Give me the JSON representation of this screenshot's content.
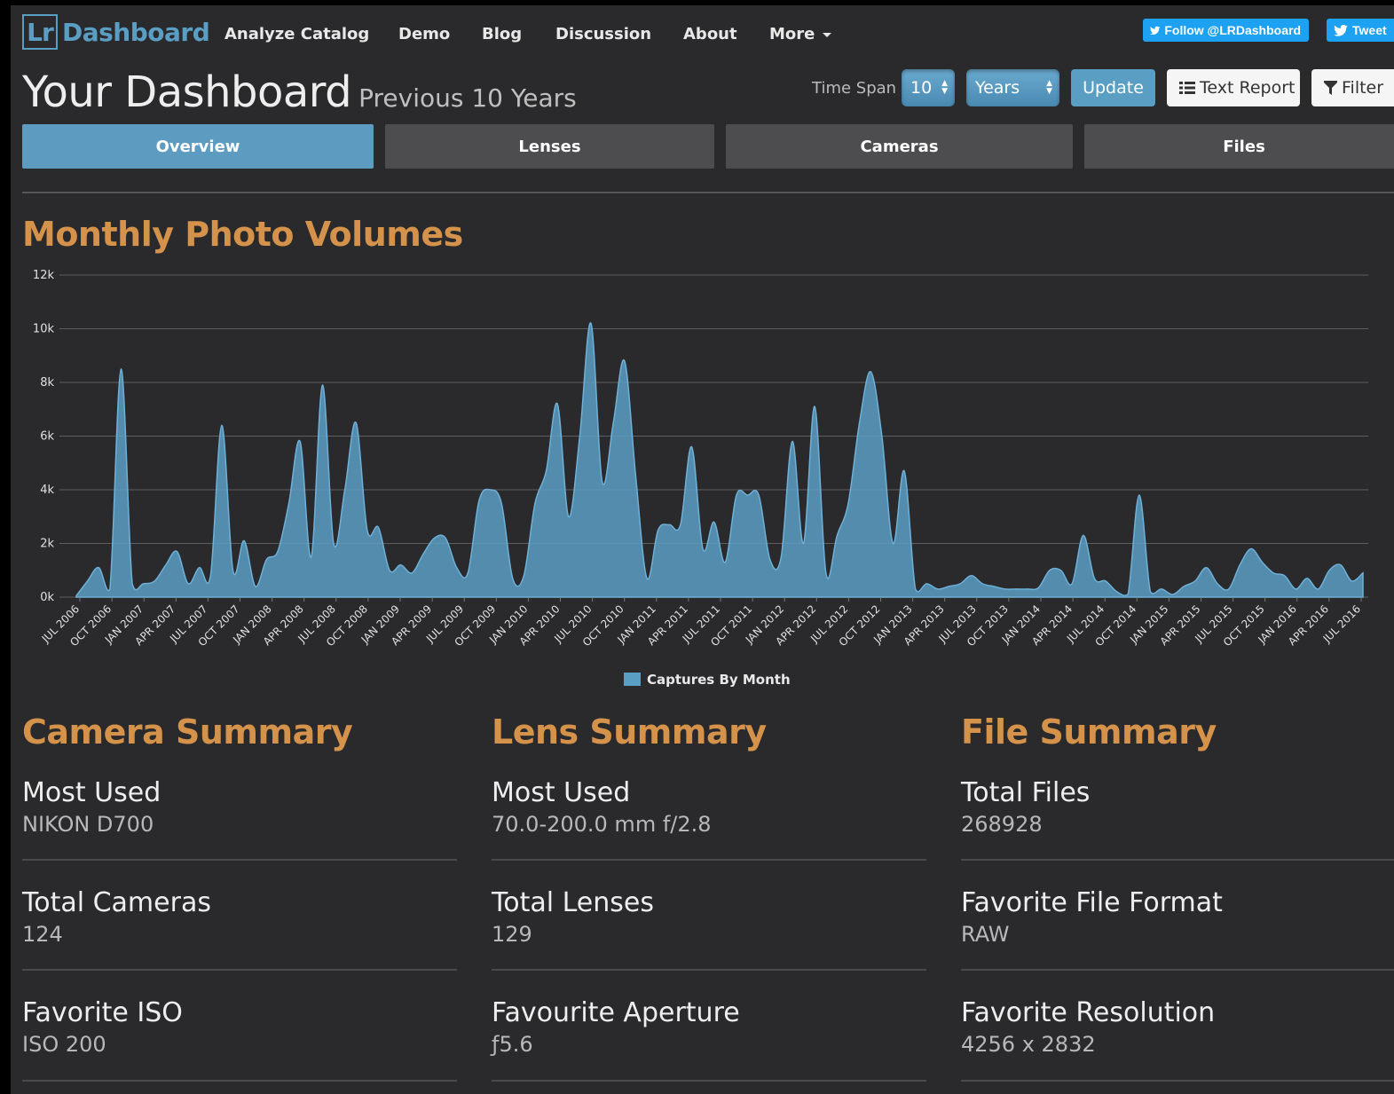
{
  "brand": {
    "lr": "Lr",
    "name": "Dashboard"
  },
  "nav": [
    "Analyze Catalog",
    "Demo",
    "Blog",
    "Discussion",
    "About",
    "More"
  ],
  "social": {
    "follow": "Follow @LRDashboard",
    "tweet": "Tweet"
  },
  "header": {
    "title": "Your Dashboard",
    "subtitle": "Previous 10 Years",
    "timespan_label": "Time Span",
    "timespan_value": "10",
    "unit_value": "Years",
    "update": "Update",
    "text_report": "Text Report",
    "filter": "Filter"
  },
  "tabs": [
    "Overview",
    "Lenses",
    "Cameras",
    "Files"
  ],
  "colors": {
    "accent": "#5b9ec4",
    "heading": "#d4924a",
    "background": "#2a2a2c"
  },
  "chart_heading": "Monthly Photo Volumes",
  "chart_data": {
    "type": "area",
    "title": "Monthly Photo Volumes",
    "legend": "Captures By Month",
    "legend_position": "bottom",
    "ylim": [
      0,
      12000
    ],
    "yticks": [
      "0k",
      "2k",
      "4k",
      "6k",
      "8k",
      "10k",
      "12k"
    ],
    "xticks": [
      "JUL 2006",
      "OCT 2006",
      "JAN 2007",
      "APR 2007",
      "JUL 2007",
      "OCT 2007",
      "JAN 2008",
      "APR 2008",
      "JUL 2008",
      "OCT 2008",
      "JAN 2009",
      "APR 2009",
      "JUL 2009",
      "OCT 2009",
      "JAN 2010",
      "APR 2010",
      "JUL 2010",
      "OCT 2010",
      "JAN 2011",
      "APR 2011",
      "JUL 2011",
      "OCT 2011",
      "JAN 2012",
      "APR 2012",
      "JUL 2012",
      "OCT 2012",
      "JAN 2013",
      "APR 2013",
      "JUL 2013",
      "OCT 2013",
      "JAN 2014",
      "APR 2014",
      "JUL 2014",
      "OCT 2014",
      "JAN 2015",
      "APR 2015",
      "JUL 2015",
      "OCT 2015",
      "JAN 2016",
      "APR 2016",
      "JUL 2016"
    ],
    "values": [
      50,
      600,
      1100,
      300,
      8500,
      500,
      500,
      600,
      1200,
      1700,
      500,
      1100,
      800,
      6400,
      1000,
      2100,
      400,
      1400,
      1700,
      3500,
      5800,
      1500,
      7900,
      2000,
      4000,
      6500,
      2500,
      2600,
      1000,
      1200,
      900,
      1600,
      2200,
      2200,
      1100,
      900,
      3600,
      4000,
      3500,
      700,
      800,
      3500,
      4700,
      7200,
      3000,
      6000,
      10200,
      4300,
      6500,
      8800,
      4500,
      700,
      2500,
      2700,
      2700,
      5600,
      1800,
      2800,
      1300,
      3800,
      3800,
      3800,
      1400,
      1500,
      5800,
      2000,
      7100,
      900,
      2300,
      3500,
      6500,
      8400,
      6000,
      2000,
      4700,
      300,
      500,
      300,
      400,
      500,
      800,
      500,
      400,
      300,
      300,
      300,
      350,
      1000,
      1000,
      500,
      2300,
      700,
      600,
      200,
      100,
      3800,
      200,
      300,
      100,
      400,
      600,
      1100,
      500,
      300,
      1200,
      1800,
      1300,
      900,
      800,
      300,
      700,
      300,
      1000,
      1200,
      600,
      900
    ]
  },
  "camera": {
    "title": "Camera Summary",
    "items": [
      {
        "key": "Most Used",
        "value": "NIKON D700"
      },
      {
        "key": "Total Cameras",
        "value": "124"
      },
      {
        "key": "Favorite ISO",
        "value": "ISO 200"
      }
    ]
  },
  "lens": {
    "title": "Lens Summary",
    "items": [
      {
        "key": "Most Used",
        "value": "70.0-200.0 mm f/2.8"
      },
      {
        "key": "Total Lenses",
        "value": "129"
      },
      {
        "key": "Favourite Aperture",
        "value": "ƒ5.6"
      }
    ]
  },
  "file": {
    "title": "File Summary",
    "items": [
      {
        "key": "Total Files",
        "value": "268928"
      },
      {
        "key": "Favorite File Format",
        "value": "RAW"
      },
      {
        "key": "Favorite Resolution",
        "value": "4256 x 2832"
      }
    ]
  }
}
